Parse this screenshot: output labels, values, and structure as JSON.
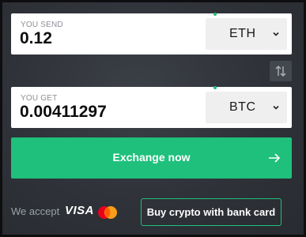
{
  "send": {
    "label": "YOU SEND",
    "amount": "0.12",
    "currency": "ETH"
  },
  "get": {
    "label": "YOU GET",
    "amount": "0.00411297",
    "currency": "BTC"
  },
  "exchange_button": {
    "label": "Exchange now",
    "icon": "arrow-right-icon"
  },
  "swap_button": {
    "icon": "swap-arrows-icon"
  },
  "footer": {
    "accept_label": "We accept",
    "visa_label": "VISA",
    "mastercard_icon": "mastercard-icon",
    "buy_label": "Buy crypto with bank card"
  },
  "colors": {
    "accent": "#1fc07c",
    "background": "#2f3238",
    "field": "#ffffff",
    "selector": "#efefef"
  }
}
